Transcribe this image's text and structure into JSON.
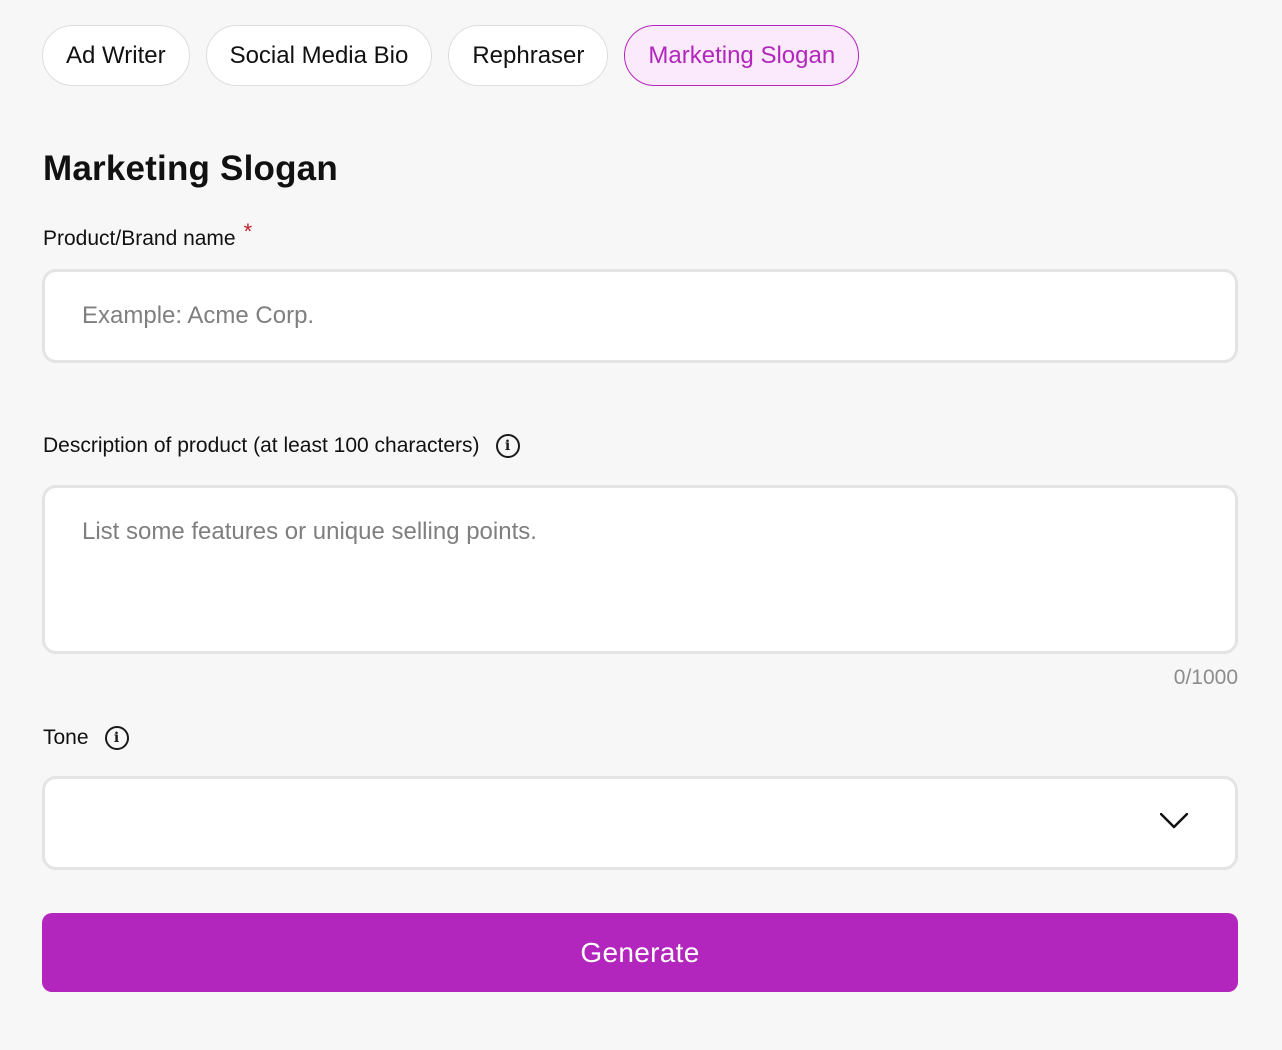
{
  "tabs": [
    {
      "label": "Ad Writer",
      "active": false
    },
    {
      "label": "Social Media Bio",
      "active": false
    },
    {
      "label": "Rephraser",
      "active": false
    },
    {
      "label": "Marketing Slogan",
      "active": true
    }
  ],
  "form": {
    "title": "Marketing Slogan",
    "brand_name": {
      "label": "Product/Brand name",
      "required_mark": "*",
      "value": "",
      "placeholder": "Example: Acme Corp."
    },
    "description": {
      "label": "Description of product (at least 100 characters)",
      "info_icon": "info-icon",
      "value": "",
      "placeholder": "List some features or unique selling points.",
      "counter": "0/1000"
    },
    "tone": {
      "label": "Tone",
      "info_icon": "info-icon",
      "selected": "",
      "dropdown_icon": "chevron-down-icon"
    },
    "generate_label": "Generate"
  },
  "colors": {
    "accent": "#b326bd",
    "active_tab_background": "#fbeafb",
    "background": "#f7f7f7",
    "required": "#c0202a"
  }
}
